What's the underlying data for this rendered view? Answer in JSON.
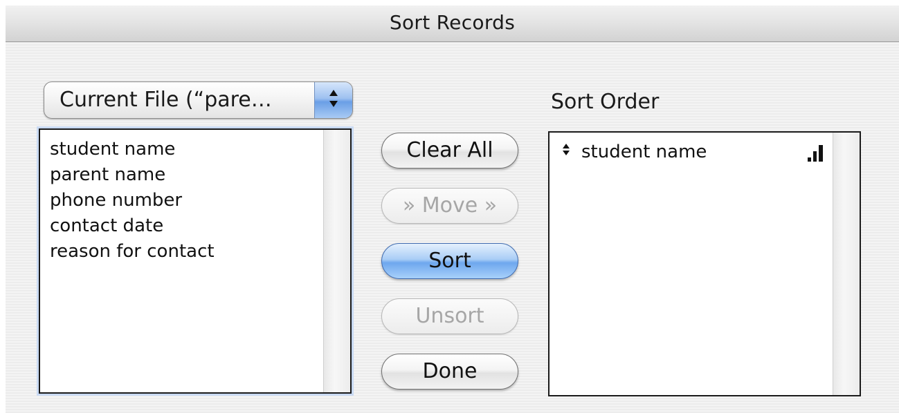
{
  "window": {
    "title": "Sort Records"
  },
  "source": {
    "popup_label": "Current File (“pare…",
    "fields": [
      "student name",
      "parent name",
      "phone number",
      "contact date",
      "reason for contact"
    ]
  },
  "buttons": {
    "clear_all": "Clear All",
    "move": "» Move »",
    "sort": "Sort",
    "unsort": "Unsort",
    "done": "Done"
  },
  "sort_order": {
    "title": "Sort Order",
    "items": [
      {
        "label": "student name",
        "direction_icon": "ascending-order-icon"
      }
    ]
  },
  "colors": {
    "default_button": "#6ea7ee",
    "disabled_text": "#a6a6a6"
  }
}
